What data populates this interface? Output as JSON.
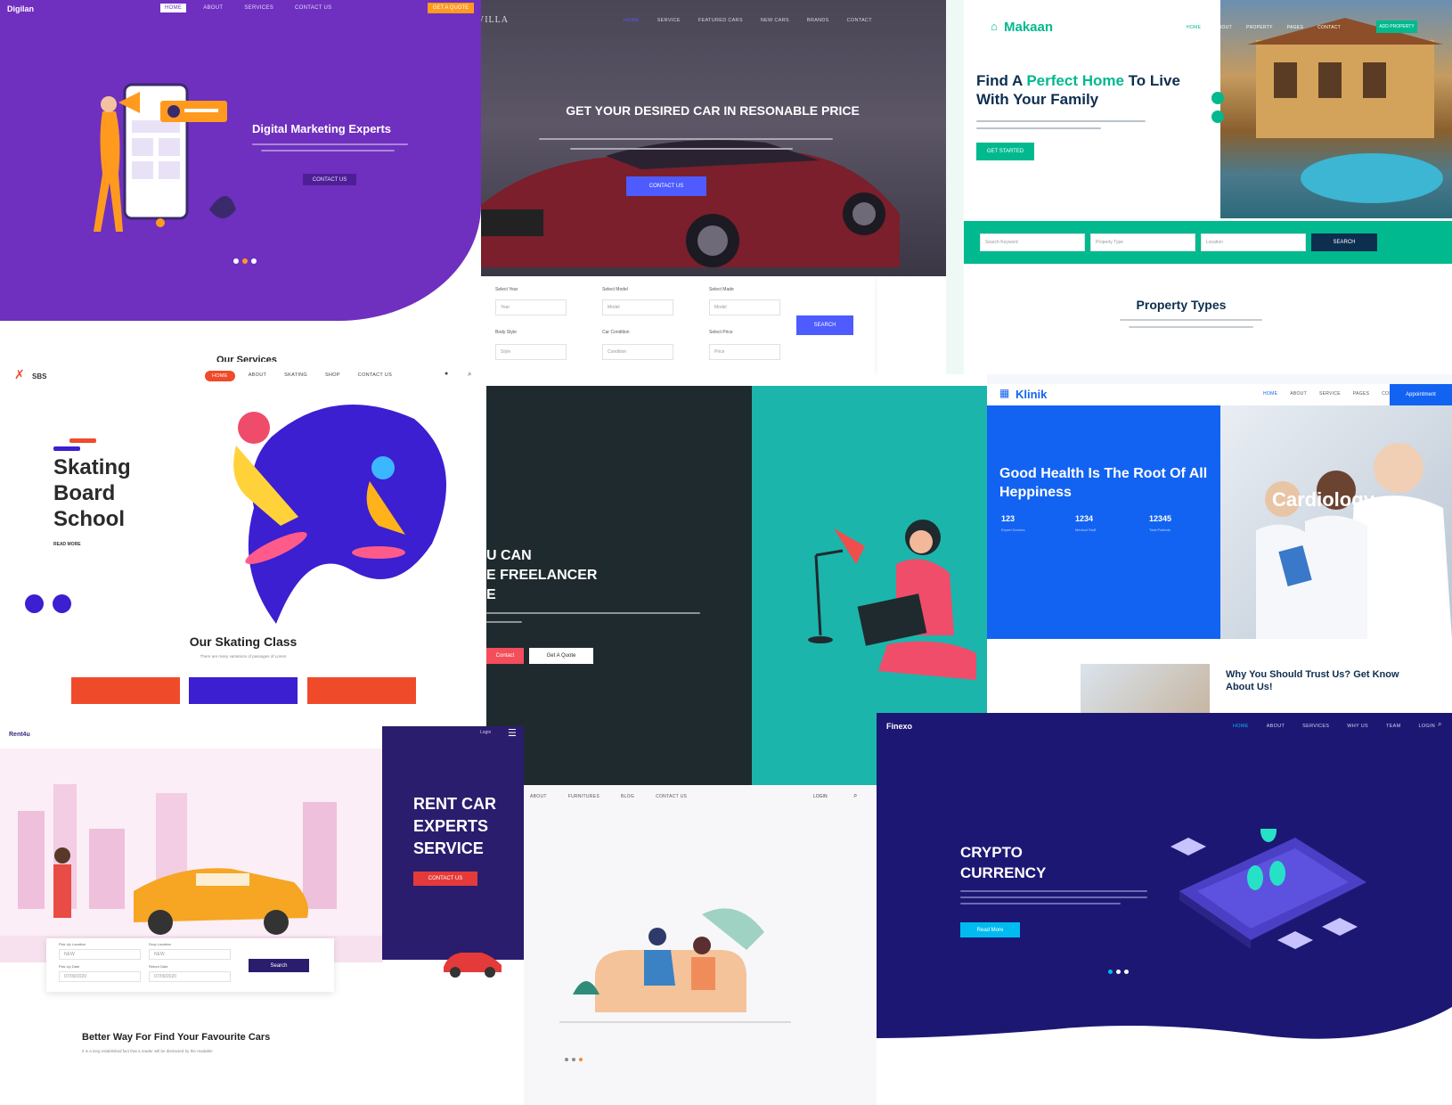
{
  "digilan": {
    "logo": "Digilan",
    "nav": [
      "HOME",
      "ABOUT",
      "SERVICES",
      "CONTACT US"
    ],
    "cta": "GET A QUOTE",
    "title": "Digital Marketing Experts",
    "button": "CONTACT US",
    "colors": {
      "bg": "#6f2fbf",
      "accent": "#ff9a1f"
    }
  },
  "villa": {
    "logo": "VILLA",
    "nav": [
      "HOME",
      "SERVICE",
      "FEATURED CARS",
      "NEW CARS",
      "BRANDS",
      "CONTACT"
    ],
    "title": "GET YOUR DESIRED CAR IN RESONABLE PRICE",
    "button": "CONTACT US",
    "filters": {
      "labels": [
        "Select Year",
        "Select Model",
        "Select Made",
        "Body Style",
        "Car Condition",
        "Select Price"
      ],
      "values": [
        "Year",
        "Model",
        "Model",
        "Style",
        "Condition",
        "Price"
      ],
      "search": "SEARCH"
    }
  },
  "makaan": {
    "logo": "Makaan",
    "nav": [
      "HOME",
      "ABOUT",
      "PROPERTY",
      "PAGES",
      "CONTACT"
    ],
    "cta": "ADD PROPERTY",
    "title_pre": "Find A ",
    "title_highlight": "Perfect Home",
    "title_post": " To Live With Your Family",
    "button": "Get Started",
    "search_fields": [
      "Search Keyword",
      "Property Type",
      "Location"
    ],
    "search_button": "Search",
    "section_title": "Property Types",
    "colors": {
      "green": "#00b98e"
    }
  },
  "sbs": {
    "logo": "SBS",
    "section_top": "Our Services",
    "nav": [
      "HOME",
      "ABOUT",
      "SKATING",
      "SHOP",
      "CONTACT US"
    ],
    "title_lines": [
      "Skating",
      "Board",
      "School"
    ],
    "read_more": "READ MORE",
    "class_title": "Our Skating Class",
    "class_sub": "There are many variations of passages of Lorem"
  },
  "freelancer": {
    "title_lines": [
      "U CAN",
      "E FREELANCER",
      "E"
    ],
    "buttons": [
      "Contact",
      "Get A Quote"
    ],
    "colors": {
      "dark": "#1f2a2e",
      "teal": "#1bb5ac"
    }
  },
  "klinik": {
    "logo": "Klinik",
    "nav": [
      "HOME",
      "ABOUT",
      "SERVICE",
      "PAGES",
      "CONTACT"
    ],
    "cta": "Appointment",
    "title": "Good Health Is The Root Of All Heppiness",
    "stats": [
      "123",
      "1234",
      "12345"
    ],
    "stat_labels": [
      "Expert Doctors",
      "Medical Stuff",
      "Total Patients"
    ],
    "overlay_word": "Cardiology",
    "about_title": "Why You Should Trust Us? Get Know About Us!",
    "colors": {
      "blue": "#1363f2"
    }
  },
  "rent4u": {
    "logo": "Rent4u",
    "side_title_lines": [
      "RENT CAR",
      "EXPERTS",
      "SERVICE"
    ],
    "side_button": "CONTACT US",
    "login": "Login",
    "form_labels": [
      "Pick Up Location",
      "Drop Location",
      "Pick Up Date",
      "Return Date"
    ],
    "form_values": [
      "NEW",
      "NEW",
      "07/09/2020",
      "07/09/2020"
    ],
    "search": "Search",
    "section_title": "Better Way For Find Your Favourite Cars",
    "section_sub": "It is a long established fact that a reader will be distracted by the readable"
  },
  "furniture": {
    "nav": [
      "ABOUT",
      "FURNITURES",
      "BLOG",
      "CONTACT US"
    ],
    "login": "LOGIN"
  },
  "finexo": {
    "logo": "Finexo",
    "nav": [
      "HOME",
      "ABOUT",
      "SERVICES",
      "WHY US",
      "TEAM",
      "LOGIN"
    ],
    "title_lines": [
      "CRYPTO",
      "CURRENCY"
    ],
    "button": "Read More",
    "colors": {
      "bg": "#1d1774",
      "accent": "#00bbf0"
    }
  }
}
